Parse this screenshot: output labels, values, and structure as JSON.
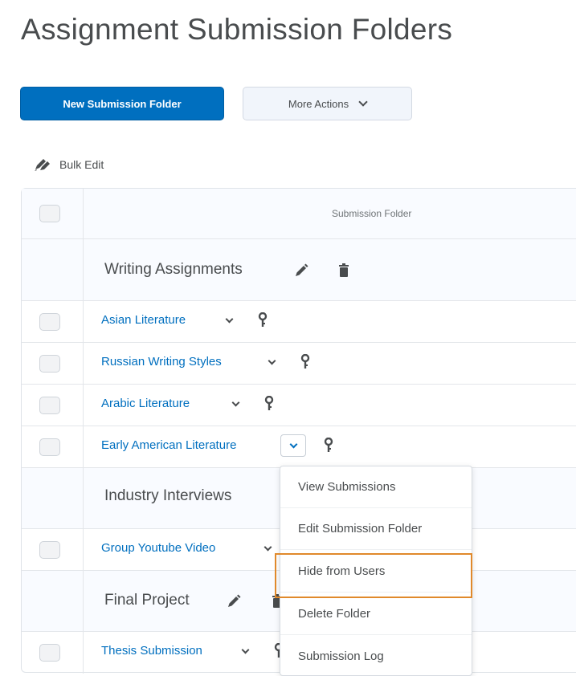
{
  "page": {
    "title": "Assignment Submission Folders"
  },
  "toolbar": {
    "new_folder_label": "New Submission Folder",
    "more_actions_label": "More Actions",
    "bulk_edit_label": "Bulk Edit"
  },
  "table": {
    "column_header": "Submission Folder",
    "groups": [
      {
        "label": "Writing Assignments",
        "items": [
          "Asian Literature",
          "Russian Writing Styles",
          "Arabic Literature",
          "Early American Literature"
        ]
      },
      {
        "label": "Industry Interviews",
        "items": [
          "Group Youtube Video"
        ]
      },
      {
        "label": "Final Project",
        "items": [
          "Thesis Submission"
        ]
      }
    ]
  },
  "context_menu": {
    "open_for": "Early American Literature",
    "items": [
      "View Submissions",
      "Edit Submission Folder",
      "Hide from Users",
      "Delete Folder",
      "Submission Log"
    ],
    "highlighted": "Hide from Users"
  },
  "icons": {
    "edit": "pencil-icon",
    "delete": "trash-icon",
    "restrictions": "key-icon",
    "bulk_edit": "pencils-icon",
    "dropdown": "chevron-down-icon"
  },
  "colors": {
    "primary": "#006fbf",
    "highlight_border": "#e0892b",
    "text": "#494c4e"
  }
}
